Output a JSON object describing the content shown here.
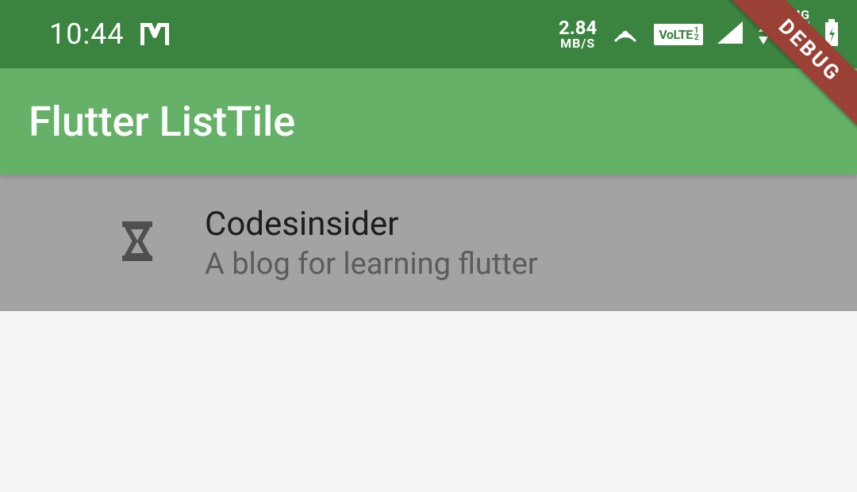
{
  "status": {
    "time": "10:44",
    "speed_value": "2.84",
    "speed_unit": "MB/S",
    "volte_label": "VoLTE",
    "network_label": "4G"
  },
  "appbar": {
    "title": "Flutter ListTile"
  },
  "list": {
    "items": [
      {
        "title": "Codesinsider",
        "subtitle": "A blog for learning flutter",
        "icon": "hourglass-icon"
      }
    ]
  },
  "debug": {
    "label": "DEBUG"
  }
}
